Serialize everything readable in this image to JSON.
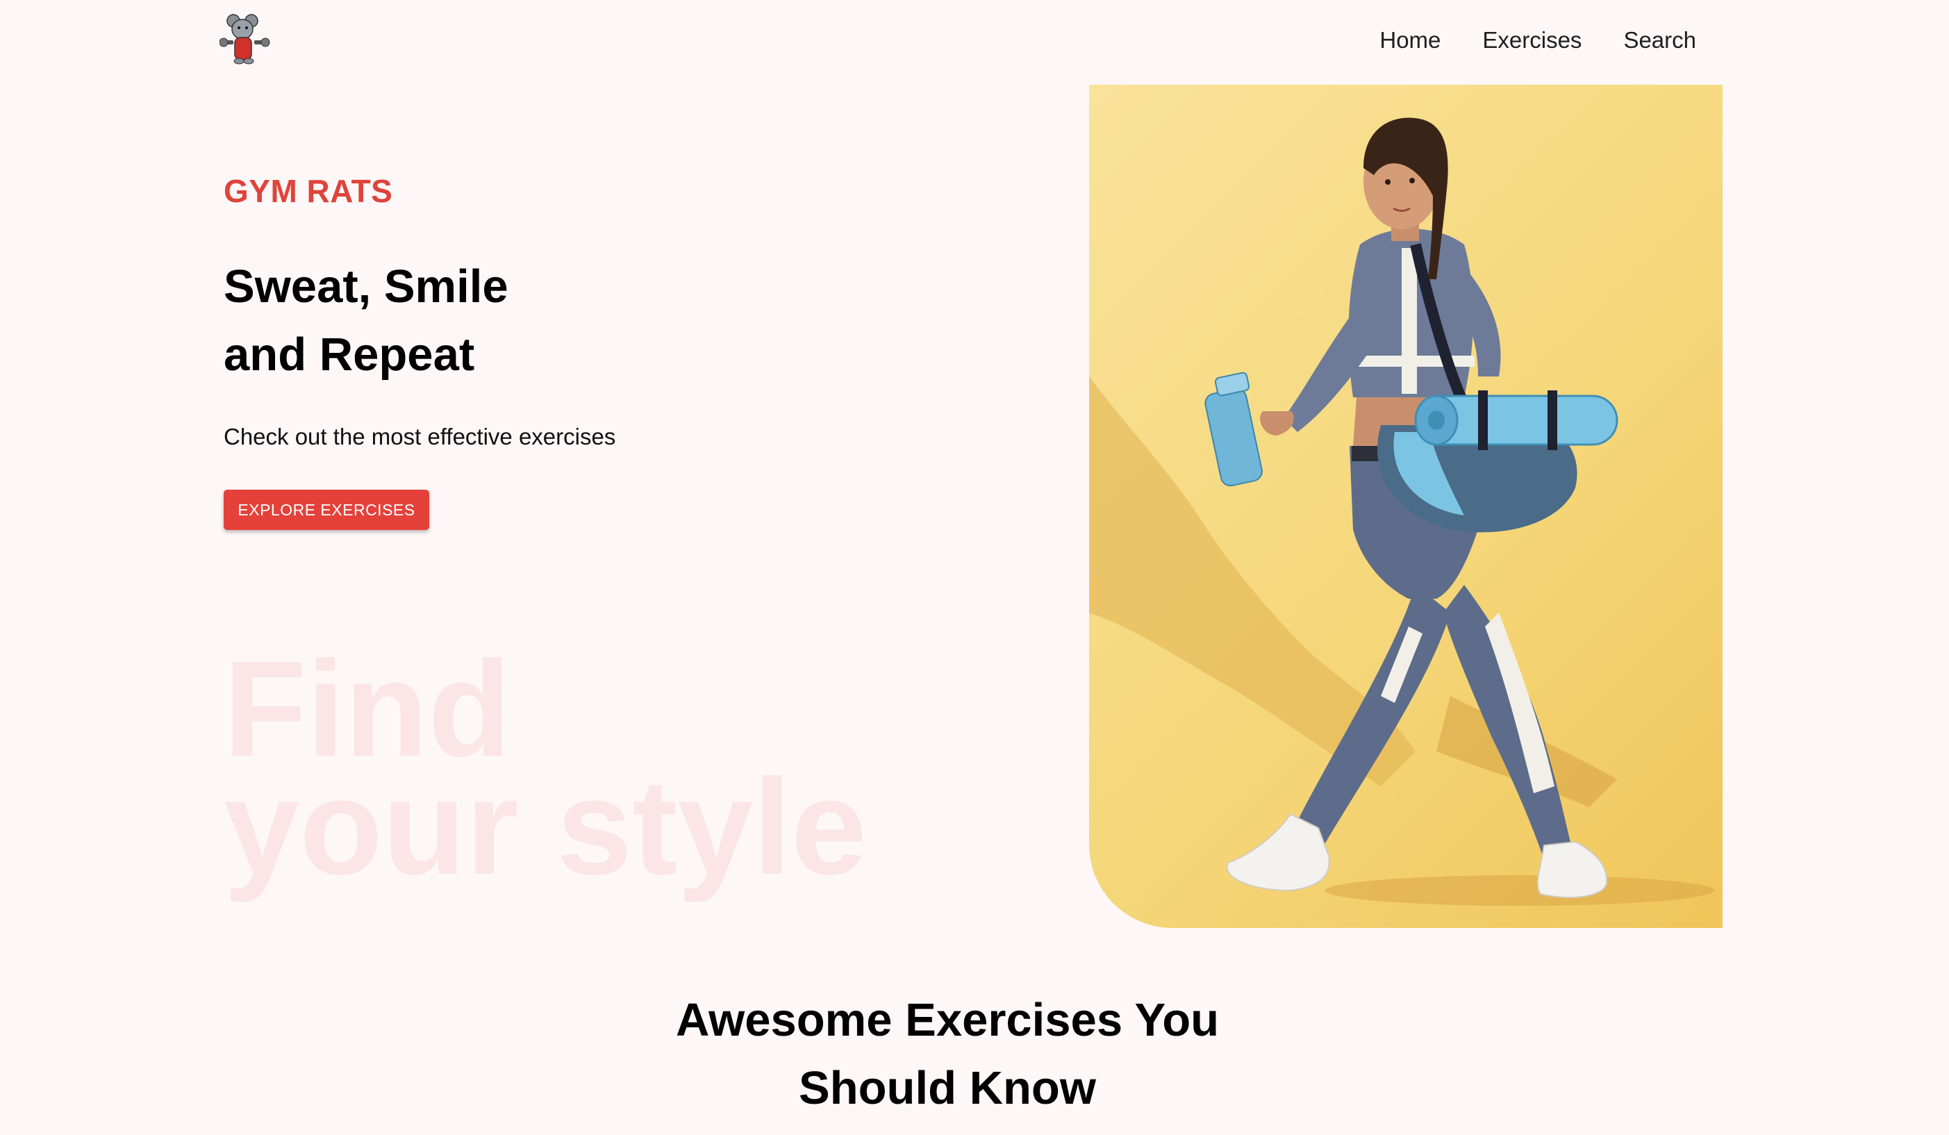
{
  "navbar": {
    "logo_icon": "rat-with-dumbbell-logo-icon",
    "links": [
      {
        "label": "Home"
      },
      {
        "label": "Exercises"
      },
      {
        "label": "Search"
      }
    ]
  },
  "hero": {
    "brand": "GYM RATS",
    "headline_line1": "Sweat, Smile",
    "headline_line2": "and Repeat",
    "subtext": "Check out the most effective exercises",
    "cta_label": "Explore Exercises",
    "background_text_line1": "Find",
    "background_text_line2": "your style",
    "image_description_icon": "woman-walking-with-gym-bag-image"
  },
  "section": {
    "title_line1": "Awesome Exercises You",
    "title_line2": "Should Know"
  },
  "colors": {
    "accent": "#e4413a",
    "background": "#fdf7f8",
    "faded_text": "#fbe5e6",
    "image_background": "#f5d77a"
  }
}
